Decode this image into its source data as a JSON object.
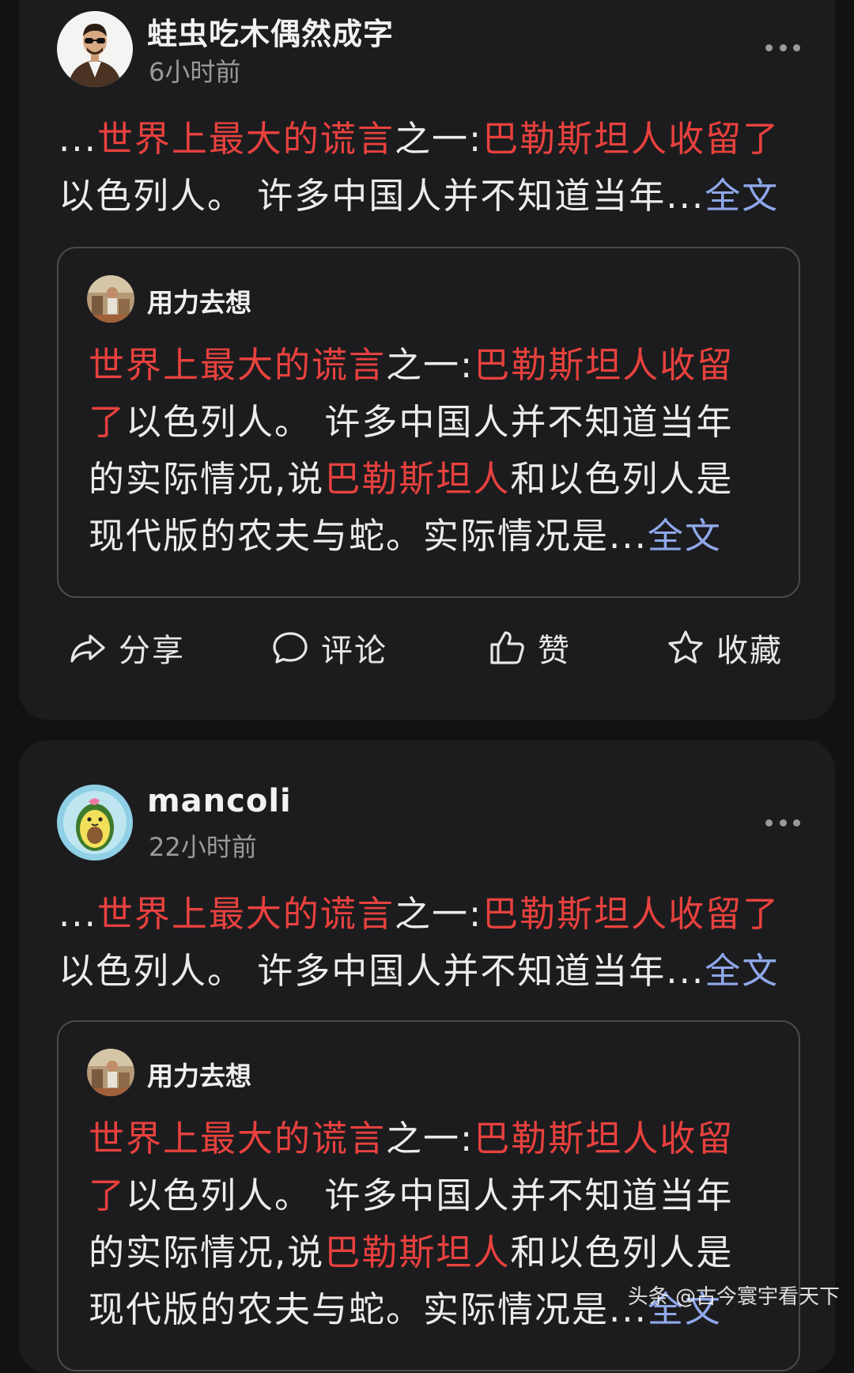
{
  "posts": [
    {
      "author": "蛙虫吃木偶然成字",
      "time": "6小时前",
      "excerpt": {
        "p1": "...",
        "p2": "世界上最大的谎言",
        "p3": "之一:",
        "p4": "巴勒斯坦人收留了",
        "p5": "以色列人。 许多中国人并不知道当年...",
        "link": "全文"
      },
      "quote": {
        "author": "用力去想",
        "t1": "世界上最大的谎言",
        "t2": "之一:",
        "t3": "巴勒斯坦人收留了",
        "t4": "以色列人。 许多中国人并不知道当年的实际情况,说",
        "t5": "巴勒斯坦人",
        "t6": "和以色列人是现代版的农夫与蛇。实际情况是...",
        "link": "全文"
      },
      "actions": {
        "share": "分享",
        "comment": "评论",
        "like": "赞",
        "favorite": "收藏"
      }
    },
    {
      "author": "mancoli",
      "time": "22小时前",
      "excerpt": {
        "p1": "...",
        "p2": "世界上最大的谎言",
        "p3": "之一:",
        "p4": "巴勒斯坦人收留了",
        "p5": "以色列人。 许多中国人并不知道当年...",
        "link": "全文"
      },
      "quote": {
        "author": "用力去想",
        "t1": "世界上最大的谎言",
        "t2": "之一:",
        "t3": "巴勒斯坦人收留了",
        "t4": "以色列人。 许多中国人并不知道当年的实际情况,说",
        "t5": "巴勒斯坦人",
        "t6": "和以色列人是现代版的农夫与蛇。实际情况是...",
        "link": "全文"
      }
    }
  ],
  "watermark": "头条 @古今寰宇看天下",
  "colors": {
    "highlight": "#e8413e",
    "link": "#8fa8ea",
    "background": "#121212",
    "card": "#1c1c1e"
  },
  "icons": [
    "more-icon",
    "share-icon",
    "comment-icon",
    "thumbs-up-icon",
    "star-icon"
  ]
}
